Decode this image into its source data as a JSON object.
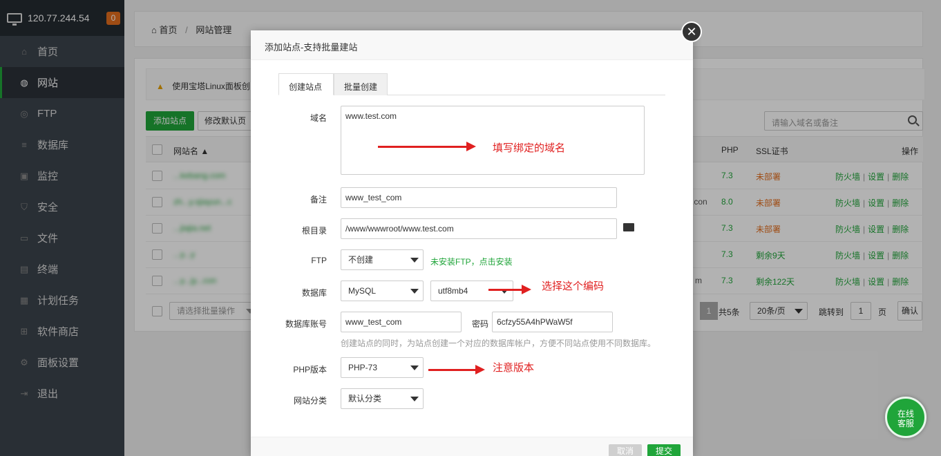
{
  "sidebar": {
    "ip": "120.77.244.54",
    "badge": "0",
    "items": [
      {
        "label": "首页"
      },
      {
        "label": "网站"
      },
      {
        "label": "FTP"
      },
      {
        "label": "数据库"
      },
      {
        "label": "监控"
      },
      {
        "label": "安全"
      },
      {
        "label": "文件"
      },
      {
        "label": "终端"
      },
      {
        "label": "计划任务"
      },
      {
        "label": "软件商店"
      },
      {
        "label": "面板设置"
      },
      {
        "label": "退出"
      }
    ]
  },
  "breadcrumb": {
    "home": "首页",
    "sep": "/",
    "current": "网站管理"
  },
  "notice": "使用宝塔Linux面板创",
  "toolbar": {
    "add_site": "添加站点",
    "modify_default": "修改默认页",
    "search_placeholder": "请输入域名或备注"
  },
  "table": {
    "headers": {
      "name": "网站名 ▲",
      "php": "PHP",
      "ssl": "SSL证书",
      "ops": "操作"
    },
    "rows": [
      {
        "name": "...kebang.com",
        "extra": "",
        "php": "7.3",
        "ssl": "未部署",
        "ssl_status": "warn"
      },
      {
        "name": "zh...y.sjiayun...c",
        "extra": ".con",
        "php": "8.0",
        "ssl": "未部署",
        "ssl_status": "warn"
      },
      {
        "name": "...jiajia.net",
        "extra": "",
        "php": "7.3",
        "ssl": "未部署",
        "ssl_status": "warn"
      },
      {
        "name": "...y...y",
        "extra": "",
        "php": "7.3",
        "ssl": "剩余9天",
        "ssl_status": "ok"
      },
      {
        "name": "...y...jy...con",
        "extra": "m",
        "php": "7.3",
        "ssl": "剩余122天",
        "ssl_status": "ok"
      }
    ],
    "op_firewall": "防火墙",
    "op_settings": "设置",
    "op_delete": "删除",
    "op_sep": "|"
  },
  "pagination": {
    "batch_placeholder": "请选择批量操作",
    "current_page": "1",
    "total": "共5条",
    "per_page": "20条/页",
    "jump_label": "跳转到",
    "jump_value": "1",
    "page_unit": "页",
    "confirm": "确认"
  },
  "modal": {
    "title": "添加站点-支持批量建站",
    "tabs": [
      "创建站点",
      "批量创建"
    ],
    "domain_label": "域名",
    "domain_value": "www.test.com",
    "remark_label": "备注",
    "remark_value": "www_test_com",
    "root_label": "根目录",
    "root_value": "/www/wwwroot/www.test.com",
    "ftp_label": "FTP",
    "ftp_value": "不创建",
    "ftp_hint": "未安装FTP，点击安装",
    "db_label": "数据库",
    "db_value": "MySQL",
    "db_charset": "utf8mb4",
    "db_account_label": "数据库账号",
    "db_account_value": "www_test_com",
    "password_label": "密码",
    "password_value": "6cfzy55A4hPWaW5f",
    "db_hint": "创建站点的同时，为站点创建一个对应的数据库帐户，方便不同站点使用不同数据库。",
    "php_label": "PHP版本",
    "php_value": "PHP-73",
    "category_label": "网站分类",
    "category_value": "默认分类",
    "cancel": "取消",
    "submit": "提交"
  },
  "annotations": {
    "domain": "填写绑定的域名",
    "charset": "选择这个编码",
    "php": "注意版本"
  },
  "online_service": "在线客服",
  "colors": {
    "accent": "#20a53a",
    "warn": "#e36d1d",
    "sidebar": "#3c444d",
    "annotation": "#e02020"
  }
}
